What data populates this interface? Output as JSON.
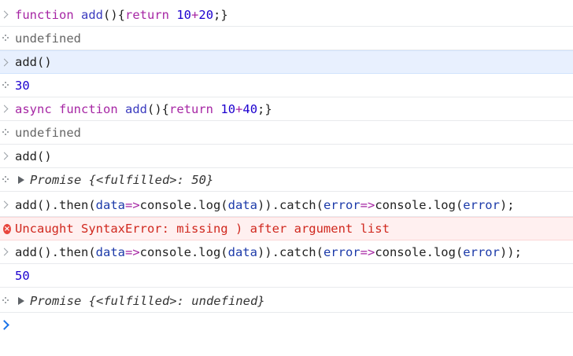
{
  "entries": [
    {
      "type": "input",
      "tokens": [
        {
          "t": "function",
          "c": "kw"
        },
        {
          "t": " ",
          "c": "pl"
        },
        {
          "t": "add",
          "c": "fn"
        },
        {
          "t": "(){",
          "c": "pl"
        },
        {
          "t": "return",
          "c": "kw"
        },
        {
          "t": " ",
          "c": "pl"
        },
        {
          "t": "10",
          "c": "num"
        },
        {
          "t": "+",
          "c": "op"
        },
        {
          "t": "20",
          "c": "num"
        },
        {
          "t": ";}",
          "c": "pl"
        }
      ]
    },
    {
      "type": "result",
      "tokens": [
        {
          "t": "undefined",
          "c": "gray"
        }
      ]
    },
    {
      "type": "input",
      "highlight": true,
      "tokens": [
        {
          "t": "add()",
          "c": "pl"
        }
      ]
    },
    {
      "type": "result",
      "tokens": [
        {
          "t": "30",
          "c": "num"
        }
      ]
    },
    {
      "type": "input",
      "tokens": [
        {
          "t": "async",
          "c": "kw"
        },
        {
          "t": " ",
          "c": "pl"
        },
        {
          "t": "function",
          "c": "kw"
        },
        {
          "t": " ",
          "c": "pl"
        },
        {
          "t": "add",
          "c": "fn"
        },
        {
          "t": "(){",
          "c": "pl"
        },
        {
          "t": "return",
          "c": "kw"
        },
        {
          "t": " ",
          "c": "pl"
        },
        {
          "t": "10",
          "c": "num"
        },
        {
          "t": "+",
          "c": "op"
        },
        {
          "t": "40",
          "c": "num"
        },
        {
          "t": ";}",
          "c": "pl"
        }
      ]
    },
    {
      "type": "result",
      "tokens": [
        {
          "t": "undefined",
          "c": "gray"
        }
      ]
    },
    {
      "type": "input",
      "tokens": [
        {
          "t": "add()",
          "c": "pl"
        }
      ]
    },
    {
      "type": "promise",
      "tokens": [
        {
          "t": "Promise {<fulfilled>: ",
          "c": "ital"
        },
        {
          "t": "50",
          "c": "num"
        },
        {
          "t": "}",
          "c": "ital"
        }
      ]
    },
    {
      "type": "input",
      "tokens": [
        {
          "t": "add().then(",
          "c": "pl"
        },
        {
          "t": "data",
          "c": "var"
        },
        {
          "t": "=>",
          "c": "op"
        },
        {
          "t": "console.log(",
          "c": "pl"
        },
        {
          "t": "data",
          "c": "var"
        },
        {
          "t": ")).catch(",
          "c": "pl"
        },
        {
          "t": "error",
          "c": "var"
        },
        {
          "t": "=>",
          "c": "op"
        },
        {
          "t": "console.log(",
          "c": "pl"
        },
        {
          "t": "error",
          "c": "var"
        },
        {
          "t": ");",
          "c": "pl"
        }
      ]
    },
    {
      "type": "error",
      "tokens": [
        {
          "t": "Uncaught SyntaxError: missing ) after argument list",
          "c": "errtxt"
        }
      ]
    },
    {
      "type": "input",
      "tokens": [
        {
          "t": "add().then(",
          "c": "pl"
        },
        {
          "t": "data",
          "c": "var"
        },
        {
          "t": "=>",
          "c": "op"
        },
        {
          "t": "console.log(",
          "c": "pl"
        },
        {
          "t": "data",
          "c": "var"
        },
        {
          "t": ")).catch(",
          "c": "pl"
        },
        {
          "t": "error",
          "c": "var"
        },
        {
          "t": "=>",
          "c": "op"
        },
        {
          "t": "console.log(",
          "c": "pl"
        },
        {
          "t": "error",
          "c": "var"
        },
        {
          "t": "));",
          "c": "pl"
        }
      ]
    },
    {
      "type": "log",
      "tokens": [
        {
          "t": "50",
          "c": "num"
        }
      ]
    },
    {
      "type": "promise",
      "tokens": [
        {
          "t": "Promise {<fulfilled>: undefined}",
          "c": "ital"
        }
      ]
    },
    {
      "type": "prompt",
      "tokens": []
    }
  ],
  "error_icon_glyph": "×",
  "colors": {
    "keyword": "#a626a4",
    "function": "#3b3bbf",
    "number": "#1c00cf",
    "error": "#d0281e",
    "highlight": "#e8f0fe",
    "prompt": "#1a73e8"
  }
}
